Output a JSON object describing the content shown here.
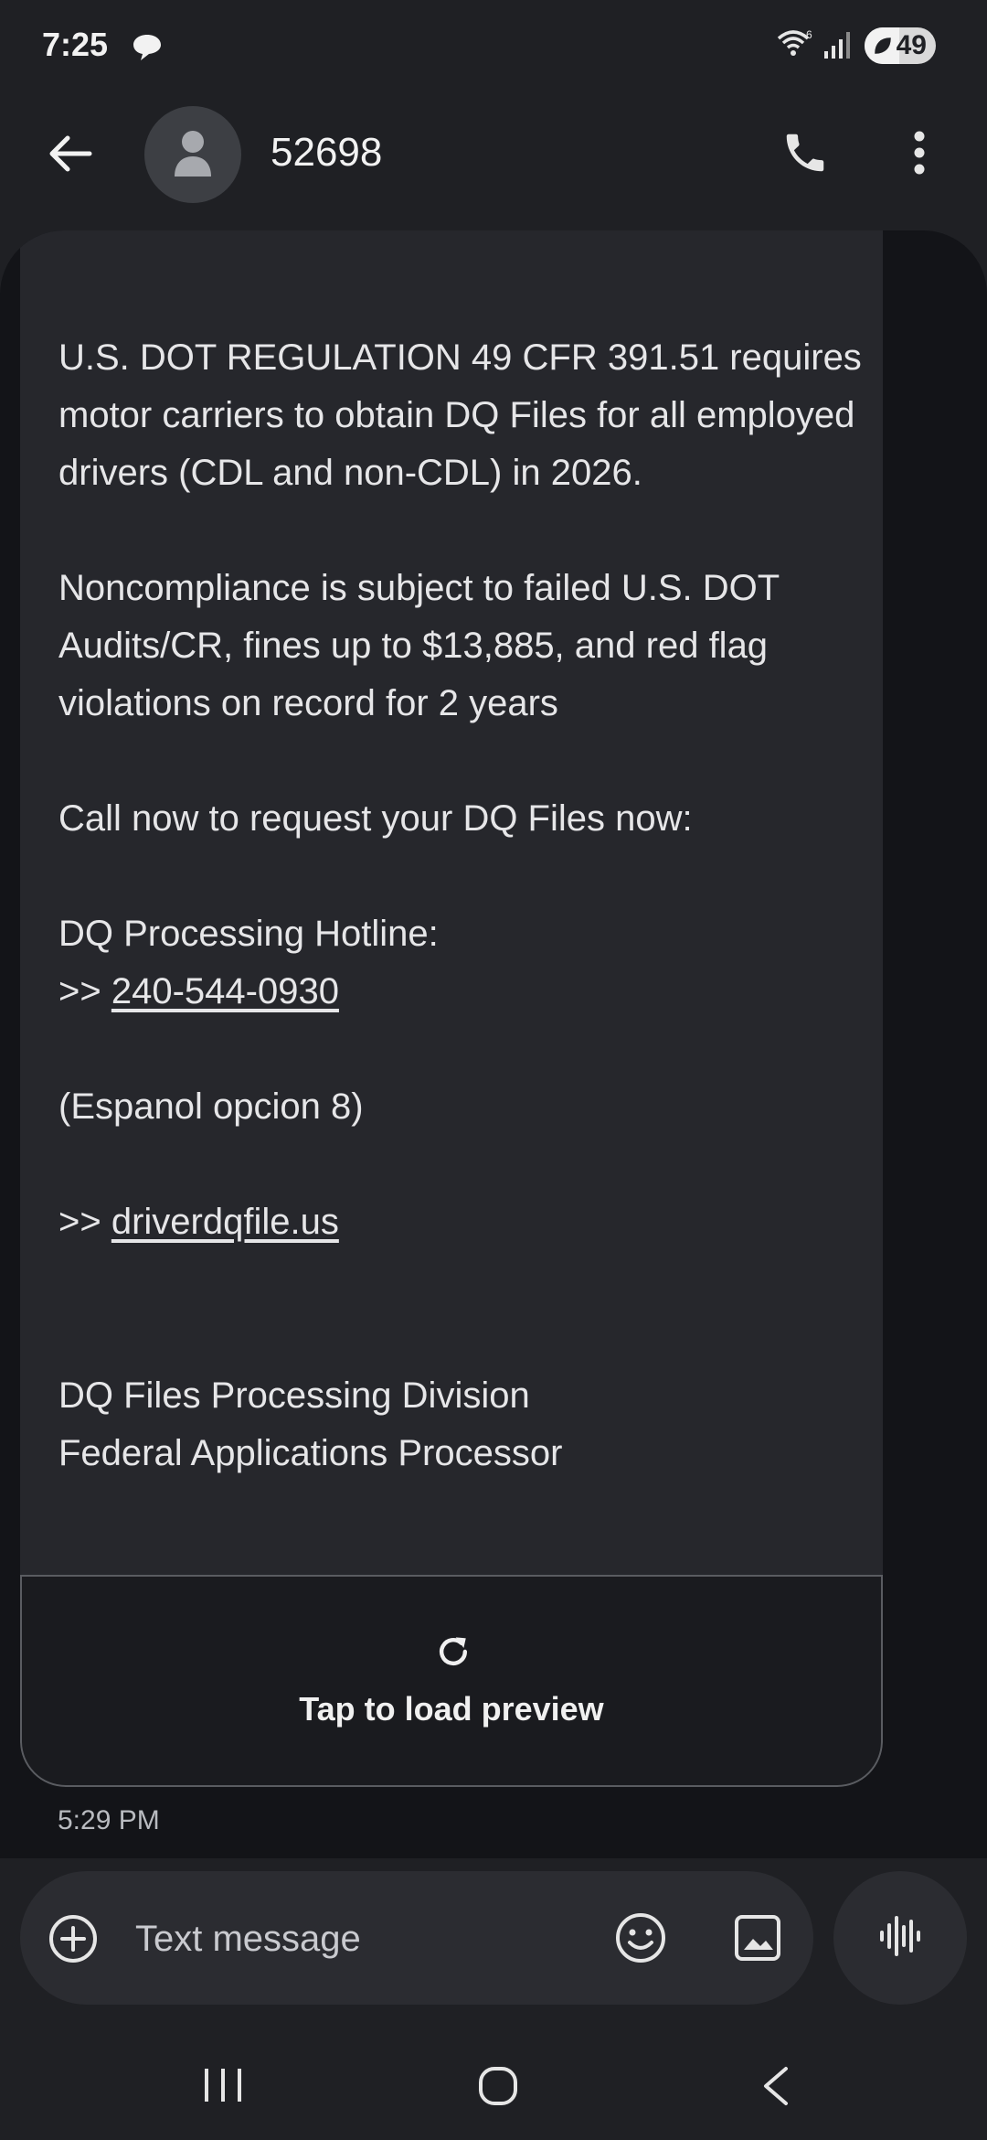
{
  "status_bar": {
    "time": "7:25",
    "battery": "49",
    "battery_level": 0.49,
    "icons": [
      "chat-bubble-icon",
      "wifi-icon",
      "signal-icon",
      "battery-icon"
    ]
  },
  "header": {
    "contact": "52698",
    "icons": [
      "back-arrow-icon",
      "person-icon",
      "phone-icon",
      "more-vert-icon"
    ]
  },
  "message": {
    "paragraph1": "U.S. DOT REGULATION 49 CFR 391.51 requires motor carriers to obtain DQ Files for all employed drivers (CDL and non-CDL) in 2026.",
    "paragraph2": "Noncompliance is subject to failed U.S. DOT Audits/CR, fines up to $13,885, and red flag violations on record for 2 years",
    "paragraph3": "Call now to request your DQ Files now:",
    "hotline_label": "DQ Processing Hotline:",
    "prefix": ">> ",
    "phone": "240-544-0930",
    "espanol": "(Espanol opcion 8)",
    "website": "driverdqfile.us",
    "signature1": "DQ Files Processing Division",
    "signature2": "Federal Applications Processor",
    "timestamp": "5:29 PM"
  },
  "preview": {
    "label": "Tap to load preview",
    "icon": "refresh-icon"
  },
  "composer": {
    "placeholder": "Text message",
    "icons": [
      "add-circle-icon",
      "emoji-icon",
      "gallery-icon",
      "voice-waveform-icon"
    ]
  },
  "navbar": {
    "icons": [
      "recents-icon",
      "home-icon",
      "nav-back-icon"
    ]
  },
  "colors": {
    "background": "#1f2024",
    "conversation": "#131418",
    "bubble": "#26272c",
    "text": "#e6e6e8"
  }
}
